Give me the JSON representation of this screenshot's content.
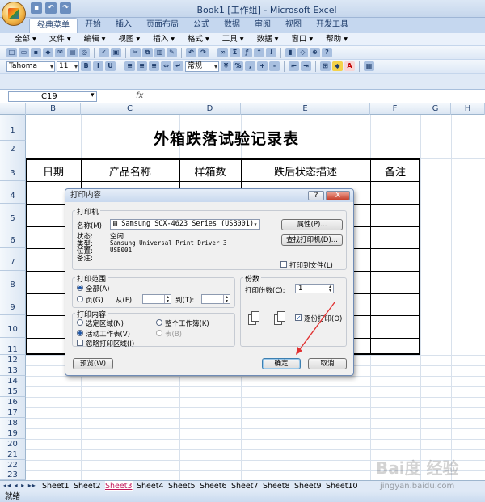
{
  "window": {
    "title": "Book1  [工作组] - Microsoft Excel"
  },
  "ribbon_tabs": [
    "经典菜单",
    "开始",
    "插入",
    "页面布局",
    "公式",
    "数据",
    "审阅",
    "视图",
    "开发工具"
  ],
  "classic_menu": [
    "全部 ▾",
    "文件 ▾",
    "编辑 ▾",
    "视图 ▾",
    "插入 ▾",
    "格式 ▾",
    "工具 ▾",
    "数据 ▾",
    "窗口 ▾",
    "帮助 ▾"
  ],
  "toolbar": {
    "font_name": "Tahoma",
    "font_size": "11",
    "number_format": "常规"
  },
  "formula_bar": {
    "cell_ref": "C19",
    "fx": "fx"
  },
  "columns": [
    "B",
    "C",
    "D",
    "E",
    "F",
    "G",
    "H"
  ],
  "rows": [
    "1",
    "2",
    "3",
    "4",
    "5",
    "6",
    "7",
    "8",
    "9",
    "10",
    "11",
    "12",
    "13",
    "14",
    "15",
    "16",
    "17",
    "18",
    "19",
    "20",
    "21",
    "22",
    "23"
  ],
  "sheet": {
    "title": "外箱跌落试验记录表",
    "headers": [
      "日期",
      "产品名称",
      "样箱数",
      "跌后状态描述",
      "备注"
    ]
  },
  "sheet_tabs": [
    "Sheet1",
    "Sheet2",
    "Sheet3",
    "Sheet4",
    "Sheet5",
    "Sheet6",
    "Sheet7",
    "Sheet8",
    "Sheet9",
    "Sheet10"
  ],
  "active_sheet": "Sheet3",
  "status": {
    "ready": "就绪"
  },
  "watermark": {
    "logo": "Bai度 经验",
    "url": "jingyan.baidu.com"
  },
  "dialog": {
    "title": "打印内容",
    "help": "?",
    "close": "X",
    "printer_group": "打印机",
    "name_label": "名称(M):",
    "printer_name": "Samsung SCX-4623 Series (USB001)",
    "status_label": "状态:",
    "status_value": "空闲",
    "type_label": "类型:",
    "type_value": "Samsung Universal Print Driver 3",
    "where_label": "位置:",
    "where_value": "USB001",
    "comment_label": "备注:",
    "properties_button": "属性(P)...",
    "find_printer_button": "查找打印机(D)...",
    "print_to_file": "打印到文件(L)",
    "range_group": "打印范围",
    "range_all": "全部(A)",
    "range_pages": "页(G)",
    "from_label": "从(F):",
    "to_label": "到(T):",
    "copies_group": "份数",
    "copies_label": "打印份数(C):",
    "copies_value": "1",
    "collate_label": "逐份打印(O)",
    "what_group": "打印内容",
    "what_selection": "选定区域(N)",
    "what_workbook": "整个工作簿(K)",
    "what_active": "活动工作表(V)",
    "what_table": "表(B)",
    "ignore_area": "忽略打印区域(I)",
    "preview_button": "预览(W)",
    "ok_button": "确定",
    "cancel_button": "取消"
  }
}
